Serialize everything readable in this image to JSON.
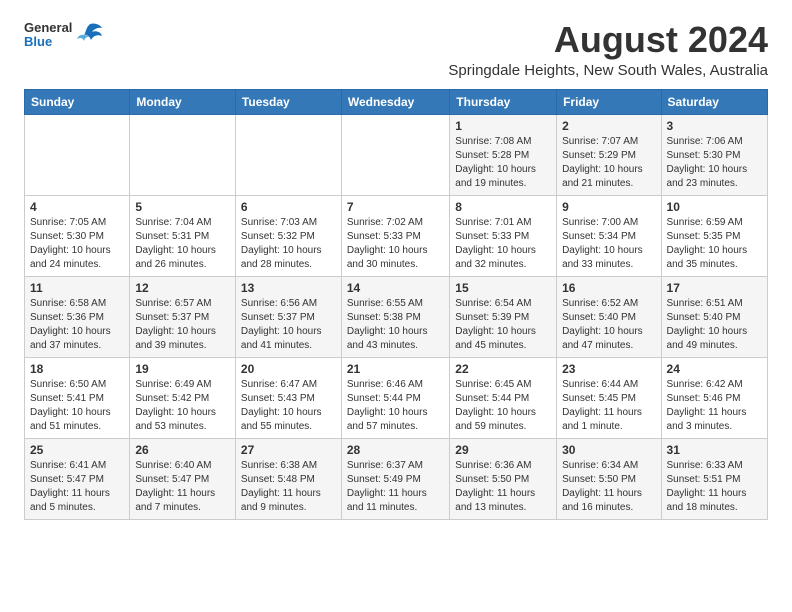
{
  "header": {
    "logo": {
      "general": "General",
      "blue": "Blue"
    },
    "title": "August 2024",
    "subtitle": "Springdale Heights, New South Wales, Australia"
  },
  "calendar": {
    "days_of_week": [
      "Sunday",
      "Monday",
      "Tuesday",
      "Wednesday",
      "Thursday",
      "Friday",
      "Saturday"
    ],
    "weeks": [
      [
        {
          "day": "",
          "info": ""
        },
        {
          "day": "",
          "info": ""
        },
        {
          "day": "",
          "info": ""
        },
        {
          "day": "",
          "info": ""
        },
        {
          "day": "1",
          "info": "Sunrise: 7:08 AM\nSunset: 5:28 PM\nDaylight: 10 hours\nand 19 minutes."
        },
        {
          "day": "2",
          "info": "Sunrise: 7:07 AM\nSunset: 5:29 PM\nDaylight: 10 hours\nand 21 minutes."
        },
        {
          "day": "3",
          "info": "Sunrise: 7:06 AM\nSunset: 5:30 PM\nDaylight: 10 hours\nand 23 minutes."
        }
      ],
      [
        {
          "day": "4",
          "info": "Sunrise: 7:05 AM\nSunset: 5:30 PM\nDaylight: 10 hours\nand 24 minutes."
        },
        {
          "day": "5",
          "info": "Sunrise: 7:04 AM\nSunset: 5:31 PM\nDaylight: 10 hours\nand 26 minutes."
        },
        {
          "day": "6",
          "info": "Sunrise: 7:03 AM\nSunset: 5:32 PM\nDaylight: 10 hours\nand 28 minutes."
        },
        {
          "day": "7",
          "info": "Sunrise: 7:02 AM\nSunset: 5:33 PM\nDaylight: 10 hours\nand 30 minutes."
        },
        {
          "day": "8",
          "info": "Sunrise: 7:01 AM\nSunset: 5:33 PM\nDaylight: 10 hours\nand 32 minutes."
        },
        {
          "day": "9",
          "info": "Sunrise: 7:00 AM\nSunset: 5:34 PM\nDaylight: 10 hours\nand 33 minutes."
        },
        {
          "day": "10",
          "info": "Sunrise: 6:59 AM\nSunset: 5:35 PM\nDaylight: 10 hours\nand 35 minutes."
        }
      ],
      [
        {
          "day": "11",
          "info": "Sunrise: 6:58 AM\nSunset: 5:36 PM\nDaylight: 10 hours\nand 37 minutes."
        },
        {
          "day": "12",
          "info": "Sunrise: 6:57 AM\nSunset: 5:37 PM\nDaylight: 10 hours\nand 39 minutes."
        },
        {
          "day": "13",
          "info": "Sunrise: 6:56 AM\nSunset: 5:37 PM\nDaylight: 10 hours\nand 41 minutes."
        },
        {
          "day": "14",
          "info": "Sunrise: 6:55 AM\nSunset: 5:38 PM\nDaylight: 10 hours\nand 43 minutes."
        },
        {
          "day": "15",
          "info": "Sunrise: 6:54 AM\nSunset: 5:39 PM\nDaylight: 10 hours\nand 45 minutes."
        },
        {
          "day": "16",
          "info": "Sunrise: 6:52 AM\nSunset: 5:40 PM\nDaylight: 10 hours\nand 47 minutes."
        },
        {
          "day": "17",
          "info": "Sunrise: 6:51 AM\nSunset: 5:40 PM\nDaylight: 10 hours\nand 49 minutes."
        }
      ],
      [
        {
          "day": "18",
          "info": "Sunrise: 6:50 AM\nSunset: 5:41 PM\nDaylight: 10 hours\nand 51 minutes."
        },
        {
          "day": "19",
          "info": "Sunrise: 6:49 AM\nSunset: 5:42 PM\nDaylight: 10 hours\nand 53 minutes."
        },
        {
          "day": "20",
          "info": "Sunrise: 6:47 AM\nSunset: 5:43 PM\nDaylight: 10 hours\nand 55 minutes."
        },
        {
          "day": "21",
          "info": "Sunrise: 6:46 AM\nSunset: 5:44 PM\nDaylight: 10 hours\nand 57 minutes."
        },
        {
          "day": "22",
          "info": "Sunrise: 6:45 AM\nSunset: 5:44 PM\nDaylight: 10 hours\nand 59 minutes."
        },
        {
          "day": "23",
          "info": "Sunrise: 6:44 AM\nSunset: 5:45 PM\nDaylight: 11 hours\nand 1 minute."
        },
        {
          "day": "24",
          "info": "Sunrise: 6:42 AM\nSunset: 5:46 PM\nDaylight: 11 hours\nand 3 minutes."
        }
      ],
      [
        {
          "day": "25",
          "info": "Sunrise: 6:41 AM\nSunset: 5:47 PM\nDaylight: 11 hours\nand 5 minutes."
        },
        {
          "day": "26",
          "info": "Sunrise: 6:40 AM\nSunset: 5:47 PM\nDaylight: 11 hours\nand 7 minutes."
        },
        {
          "day": "27",
          "info": "Sunrise: 6:38 AM\nSunset: 5:48 PM\nDaylight: 11 hours\nand 9 minutes."
        },
        {
          "day": "28",
          "info": "Sunrise: 6:37 AM\nSunset: 5:49 PM\nDaylight: 11 hours\nand 11 minutes."
        },
        {
          "day": "29",
          "info": "Sunrise: 6:36 AM\nSunset: 5:50 PM\nDaylight: 11 hours\nand 13 minutes."
        },
        {
          "day": "30",
          "info": "Sunrise: 6:34 AM\nSunset: 5:50 PM\nDaylight: 11 hours\nand 16 minutes."
        },
        {
          "day": "31",
          "info": "Sunrise: 6:33 AM\nSunset: 5:51 PM\nDaylight: 11 hours\nand 18 minutes."
        }
      ]
    ]
  }
}
